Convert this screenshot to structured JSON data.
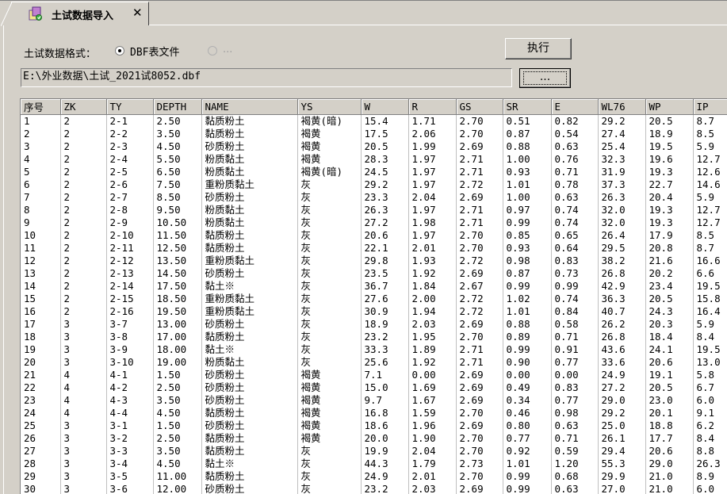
{
  "tab": {
    "title": "土试数据导入",
    "close": "✕",
    "icon": "import-data-icon"
  },
  "format": {
    "label": "土试数据格式：",
    "option1": {
      "label": "DBF表文件",
      "selected": true
    },
    "option2": {
      "label": "...",
      "selected": false,
      "disabled": true
    }
  },
  "buttons": {
    "execute": "执行",
    "browse": "..."
  },
  "path": {
    "value": "E:\\外业数据\\土试_2021试8052.dbf"
  },
  "table": {
    "columns": [
      "序号",
      "ZK",
      "TY",
      "DEPTH",
      "NAME",
      "YS",
      "W",
      "R",
      "GS",
      "SR",
      "E",
      "WL76",
      "WP",
      "IP"
    ],
    "rows": [
      [
        "1",
        "2",
        "2-1",
        "2.50",
        "黏质粉土",
        "褐黄(暗)",
        "15.4",
        "1.71",
        "2.70",
        "0.51",
        "0.82",
        "29.2",
        "20.5",
        "8.7"
      ],
      [
        "2",
        "2",
        "2-2",
        "3.50",
        "黏质粉土",
        "褐黄",
        "17.5",
        "2.06",
        "2.70",
        "0.87",
        "0.54",
        "27.4",
        "18.9",
        "8.5"
      ],
      [
        "3",
        "2",
        "2-3",
        "4.50",
        "砂质粉土",
        "褐黄",
        "20.5",
        "1.99",
        "2.69",
        "0.88",
        "0.63",
        "25.4",
        "19.5",
        "5.9"
      ],
      [
        "4",
        "2",
        "2-4",
        "5.50",
        "粉质黏土",
        "褐黄",
        "28.3",
        "1.97",
        "2.71",
        "1.00",
        "0.76",
        "32.3",
        "19.6",
        "12.7"
      ],
      [
        "5",
        "2",
        "2-5",
        "6.50",
        "粉质黏土",
        "褐黄(暗)",
        "24.5",
        "1.97",
        "2.71",
        "0.93",
        "0.71",
        "31.9",
        "19.3",
        "12.6"
      ],
      [
        "6",
        "2",
        "2-6",
        "7.50",
        "重粉质黏土",
        "灰",
        "29.2",
        "1.97",
        "2.72",
        "1.01",
        "0.78",
        "37.3",
        "22.7",
        "14.6"
      ],
      [
        "7",
        "2",
        "2-7",
        "8.50",
        "砂质粉土",
        "灰",
        "23.3",
        "2.04",
        "2.69",
        "1.00",
        "0.63",
        "26.3",
        "20.4",
        "5.9"
      ],
      [
        "8",
        "2",
        "2-8",
        "9.50",
        "粉质黏土",
        "灰",
        "26.3",
        "1.97",
        "2.71",
        "0.97",
        "0.74",
        "32.0",
        "19.3",
        "12.7"
      ],
      [
        "9",
        "2",
        "2-9",
        "10.50",
        "粉质黏土",
        "灰",
        "27.2",
        "1.98",
        "2.71",
        "0.99",
        "0.74",
        "32.0",
        "19.3",
        "12.7"
      ],
      [
        "10",
        "2",
        "2-10",
        "11.50",
        "黏质粉土",
        "灰",
        "20.6",
        "1.97",
        "2.70",
        "0.85",
        "0.65",
        "26.4",
        "17.9",
        "8.5"
      ],
      [
        "11",
        "2",
        "2-11",
        "12.50",
        "黏质粉土",
        "灰",
        "22.1",
        "2.01",
        "2.70",
        "0.93",
        "0.64",
        "29.5",
        "20.8",
        "8.7"
      ],
      [
        "12",
        "2",
        "2-12",
        "13.50",
        "重粉质黏土",
        "灰",
        "29.8",
        "1.93",
        "2.72",
        "0.98",
        "0.83",
        "38.2",
        "21.6",
        "16.6"
      ],
      [
        "13",
        "2",
        "2-13",
        "14.50",
        "砂质粉土",
        "灰",
        "23.5",
        "1.92",
        "2.69",
        "0.87",
        "0.73",
        "26.8",
        "20.2",
        "6.6"
      ],
      [
        "14",
        "2",
        "2-14",
        "17.50",
        "黏土※",
        "灰",
        "36.7",
        "1.84",
        "2.67",
        "0.99",
        "0.99",
        "42.9",
        "23.4",
        "19.5"
      ],
      [
        "15",
        "2",
        "2-15",
        "18.50",
        "重粉质黏土",
        "灰",
        "27.6",
        "2.00",
        "2.72",
        "1.02",
        "0.74",
        "36.3",
        "20.5",
        "15.8"
      ],
      [
        "16",
        "2",
        "2-16",
        "19.50",
        "重粉质黏土",
        "灰",
        "30.9",
        "1.94",
        "2.72",
        "1.01",
        "0.84",
        "40.7",
        "24.3",
        "16.4"
      ],
      [
        "17",
        "3",
        "3-7",
        "13.00",
        "砂质粉土",
        "灰",
        "18.9",
        "2.03",
        "2.69",
        "0.88",
        "0.58",
        "26.2",
        "20.3",
        "5.9"
      ],
      [
        "18",
        "3",
        "3-8",
        "17.00",
        "黏质粉土",
        "灰",
        "23.2",
        "1.95",
        "2.70",
        "0.89",
        "0.71",
        "26.8",
        "18.4",
        "8.4"
      ],
      [
        "19",
        "3",
        "3-9",
        "18.00",
        "黏土※",
        "灰",
        "33.3",
        "1.89",
        "2.71",
        "0.99",
        "0.91",
        "43.6",
        "24.1",
        "19.5"
      ],
      [
        "20",
        "3",
        "3-10",
        "19.00",
        "粉质黏土",
        "灰",
        "25.6",
        "1.92",
        "2.71",
        "0.90",
        "0.77",
        "33.6",
        "20.6",
        "13.0"
      ],
      [
        "21",
        "4",
        "4-1",
        "1.50",
        "砂质粉土",
        "褐黄",
        "7.1",
        "0.00",
        "2.69",
        "0.00",
        "0.00",
        "24.9",
        "19.1",
        "5.8"
      ],
      [
        "22",
        "4",
        "4-2",
        "2.50",
        "砂质粉土",
        "褐黄",
        "15.0",
        "1.69",
        "2.69",
        "0.49",
        "0.83",
        "27.2",
        "20.5",
        "6.7"
      ],
      [
        "23",
        "4",
        "4-3",
        "3.50",
        "砂质粉土",
        "褐黄",
        "9.7",
        "1.67",
        "2.69",
        "0.34",
        "0.77",
        "29.0",
        "23.0",
        "6.0"
      ],
      [
        "24",
        "4",
        "4-4",
        "4.50",
        "黏质粉土",
        "褐黄",
        "16.8",
        "1.59",
        "2.70",
        "0.46",
        "0.98",
        "29.2",
        "20.1",
        "9.1"
      ],
      [
        "25",
        "3",
        "3-1",
        "1.50",
        "砂质粉土",
        "褐黄",
        "18.6",
        "1.96",
        "2.69",
        "0.80",
        "0.63",
        "25.0",
        "18.8",
        "6.2"
      ],
      [
        "26",
        "3",
        "3-2",
        "2.50",
        "黏质粉土",
        "褐黄",
        "20.0",
        "1.90",
        "2.70",
        "0.77",
        "0.71",
        "26.1",
        "17.7",
        "8.4"
      ],
      [
        "27",
        "3",
        "3-3",
        "3.50",
        "黏质粉土",
        "灰",
        "19.9",
        "2.04",
        "2.70",
        "0.92",
        "0.59",
        "29.4",
        "20.6",
        "8.8"
      ],
      [
        "28",
        "3",
        "3-4",
        "4.50",
        "黏土※",
        "灰",
        "44.3",
        "1.79",
        "2.73",
        "1.01",
        "1.20",
        "55.3",
        "29.0",
        "26.3"
      ],
      [
        "29",
        "3",
        "3-5",
        "11.00",
        "黏质粉土",
        "灰",
        "24.9",
        "2.01",
        "2.70",
        "0.99",
        "0.68",
        "29.9",
        "21.0",
        "8.9"
      ],
      [
        "30",
        "3",
        "3-6",
        "12.00",
        "砂质粉土",
        "灰",
        "23.2",
        "2.03",
        "2.69",
        "0.99",
        "0.63",
        "27.0",
        "21.0",
        "6.0"
      ]
    ]
  }
}
